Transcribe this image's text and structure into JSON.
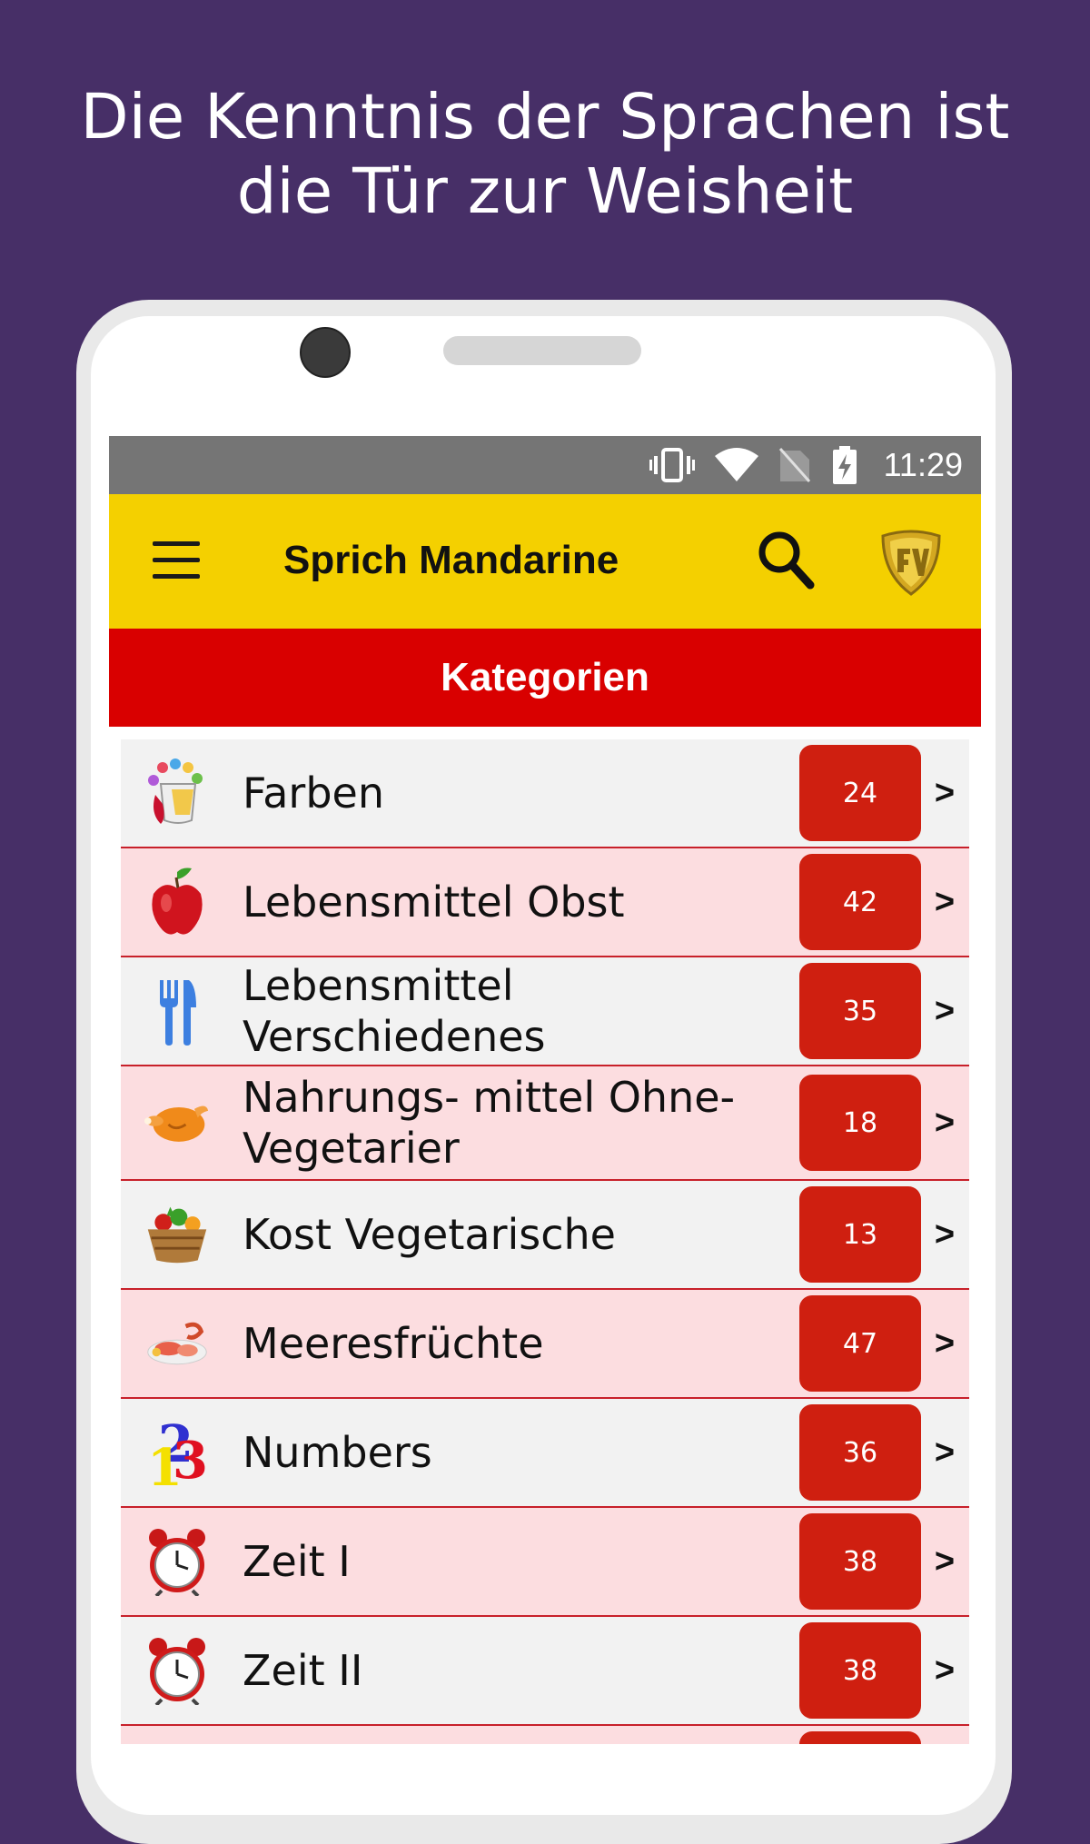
{
  "headline": {
    "line1": "Die Kenntnis der Sprachen ist",
    "line2": "die Tür zur Weisheit"
  },
  "statusbar": {
    "icons": [
      "vibrate-icon",
      "wifi-icon",
      "no-sim-icon",
      "battery-charging-icon"
    ],
    "time": "11:29"
  },
  "appbar": {
    "title": "Sprich Mandarine",
    "icons": [
      "menu-icon",
      "search-icon",
      "shield-logo-icon"
    ]
  },
  "section": {
    "title": "Kategorien"
  },
  "colors": {
    "background": "#472f67",
    "appbar": "#f4d000",
    "section": "#d90000",
    "badge": "#cf1f10",
    "row_odd": "#f2f2f2",
    "row_even": "#fcdde0"
  },
  "categories": [
    {
      "label": "Farben",
      "count": "24",
      "icon": "paint-bucket-icon"
    },
    {
      "label": "Lebensmittel Obst",
      "count": "42",
      "icon": "apple-icon"
    },
    {
      "label": "Lebensmittel Verschiedenes",
      "count": "35",
      "icon": "fork-knife-icon"
    },
    {
      "label": "Nahrungs- mittel Ohne-Vegetarier",
      "count": "18",
      "icon": "roast-chicken-icon"
    },
    {
      "label": "Kost Vegetarische",
      "count": "13",
      "icon": "vegetable-basket-icon"
    },
    {
      "label": "Meeresfrüchte",
      "count": "47",
      "icon": "seafood-icon"
    },
    {
      "label": "Numbers",
      "count": "36",
      "icon": "numbers-icon"
    },
    {
      "label": "Zeit I",
      "count": "38",
      "icon": "alarm-clock-icon"
    },
    {
      "label": "Zeit II",
      "count": "38",
      "icon": "alarm-clock-icon"
    }
  ],
  "chevron": ">"
}
